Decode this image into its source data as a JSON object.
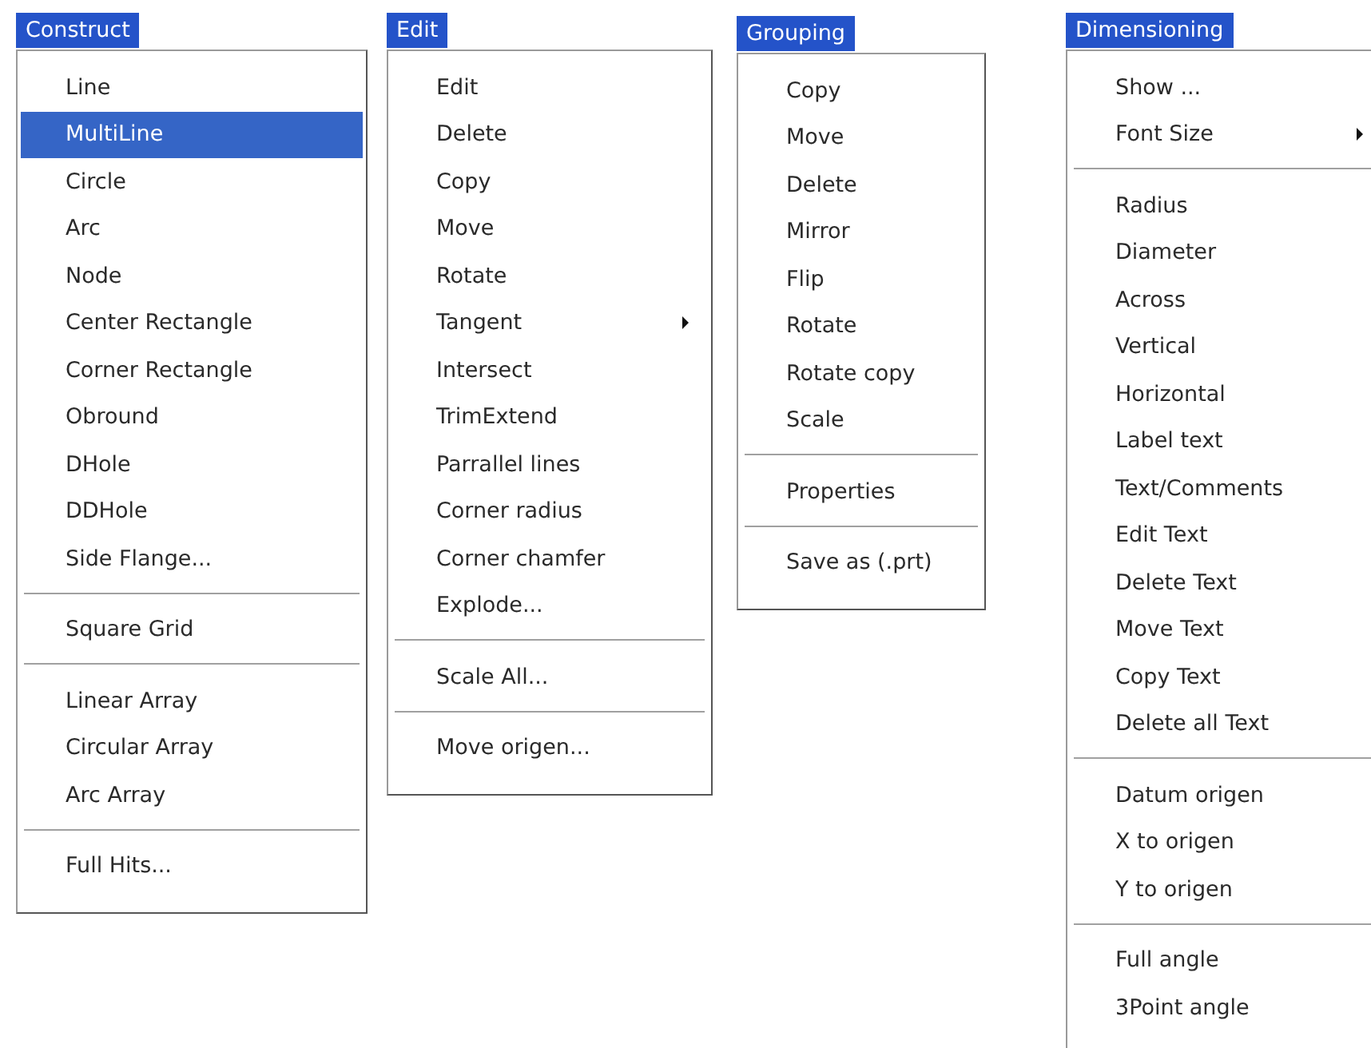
{
  "menus": [
    {
      "title": "Construct",
      "items": [
        {
          "kind": "item",
          "label": "Line",
          "selected": false
        },
        {
          "kind": "item",
          "label": "MultiLine",
          "selected": true
        },
        {
          "kind": "item",
          "label": "Circle",
          "selected": false
        },
        {
          "kind": "item",
          "label": "Arc",
          "selected": false
        },
        {
          "kind": "item",
          "label": "Node",
          "selected": false
        },
        {
          "kind": "item",
          "label": "Center Rectangle",
          "selected": false
        },
        {
          "kind": "item",
          "label": "Corner Rectangle",
          "selected": false
        },
        {
          "kind": "item",
          "label": "Obround",
          "selected": false
        },
        {
          "kind": "item",
          "label": "DHole",
          "selected": false
        },
        {
          "kind": "item",
          "label": "DDHole",
          "selected": false
        },
        {
          "kind": "item",
          "label": "Side Flange...",
          "selected": false
        },
        {
          "kind": "separator"
        },
        {
          "kind": "item",
          "label": "Square Grid",
          "selected": false
        },
        {
          "kind": "separator"
        },
        {
          "kind": "item",
          "label": "Linear Array",
          "selected": false
        },
        {
          "kind": "item",
          "label": "Circular Array",
          "selected": false
        },
        {
          "kind": "item",
          "label": "Arc Array",
          "selected": false
        },
        {
          "kind": "separator"
        },
        {
          "kind": "item",
          "label": "Full Hits...",
          "selected": false
        }
      ]
    },
    {
      "title": "Edit",
      "items": [
        {
          "kind": "item",
          "label": "Edit",
          "selected": false
        },
        {
          "kind": "item",
          "label": "Delete",
          "selected": false
        },
        {
          "kind": "item",
          "label": "Copy",
          "selected": false
        },
        {
          "kind": "item",
          "label": "Move",
          "selected": false
        },
        {
          "kind": "item",
          "label": "Rotate",
          "selected": false
        },
        {
          "kind": "submenu",
          "label": "Tangent",
          "selected": false
        },
        {
          "kind": "item",
          "label": "Intersect",
          "selected": false
        },
        {
          "kind": "item",
          "label": "TrimExtend",
          "selected": false
        },
        {
          "kind": "item",
          "label": "Parrallel lines",
          "selected": false
        },
        {
          "kind": "item",
          "label": "Corner radius",
          "selected": false
        },
        {
          "kind": "item",
          "label": "Corner chamfer",
          "selected": false
        },
        {
          "kind": "item",
          "label": "Explode...",
          "selected": false
        },
        {
          "kind": "separator"
        },
        {
          "kind": "item",
          "label": "Scale All...",
          "selected": false
        },
        {
          "kind": "separator"
        },
        {
          "kind": "item",
          "label": "Move origen...",
          "selected": false
        }
      ]
    },
    {
      "title": "Grouping",
      "items": [
        {
          "kind": "item",
          "label": "Copy",
          "selected": false
        },
        {
          "kind": "item",
          "label": "Move",
          "selected": false
        },
        {
          "kind": "item",
          "label": "Delete",
          "selected": false
        },
        {
          "kind": "item",
          "label": "Mirror",
          "selected": false
        },
        {
          "kind": "item",
          "label": "Flip",
          "selected": false
        },
        {
          "kind": "item",
          "label": "Rotate",
          "selected": false
        },
        {
          "kind": "item",
          "label": "Rotate copy",
          "selected": false
        },
        {
          "kind": "item",
          "label": "Scale",
          "selected": false
        },
        {
          "kind": "separator"
        },
        {
          "kind": "item",
          "label": "Properties",
          "selected": false
        },
        {
          "kind": "separator"
        },
        {
          "kind": "item",
          "label": "Save as (.prt)",
          "selected": false
        }
      ]
    },
    {
      "title": "Dimensioning",
      "items": [
        {
          "kind": "item",
          "label": "Show ...",
          "selected": false
        },
        {
          "kind": "submenu",
          "label": "Font Size",
          "selected": false
        },
        {
          "kind": "separator"
        },
        {
          "kind": "item",
          "label": "Radius",
          "selected": false
        },
        {
          "kind": "item",
          "label": "Diameter",
          "selected": false
        },
        {
          "kind": "item",
          "label": "Across",
          "selected": false
        },
        {
          "kind": "item",
          "label": "Vertical",
          "selected": false
        },
        {
          "kind": "item",
          "label": "Horizontal",
          "selected": false
        },
        {
          "kind": "item",
          "label": "Label text",
          "selected": false
        },
        {
          "kind": "item",
          "label": "Text/Comments",
          "selected": false
        },
        {
          "kind": "item",
          "label": "Edit Text",
          "selected": false
        },
        {
          "kind": "item",
          "label": "Delete Text",
          "selected": false
        },
        {
          "kind": "item",
          "label": "Move Text",
          "selected": false
        },
        {
          "kind": "item",
          "label": "Copy Text",
          "selected": false
        },
        {
          "kind": "item",
          "label": "Delete all Text",
          "selected": false
        },
        {
          "kind": "separator"
        },
        {
          "kind": "item",
          "label": "Datum origen",
          "selected": false
        },
        {
          "kind": "item",
          "label": "X to origen",
          "selected": false
        },
        {
          "kind": "item",
          "label": "Y to origen",
          "selected": false
        },
        {
          "kind": "separator"
        },
        {
          "kind": "item",
          "label": "Full angle",
          "selected": false
        },
        {
          "kind": "item",
          "label": "3Point angle",
          "selected": false
        }
      ]
    }
  ]
}
